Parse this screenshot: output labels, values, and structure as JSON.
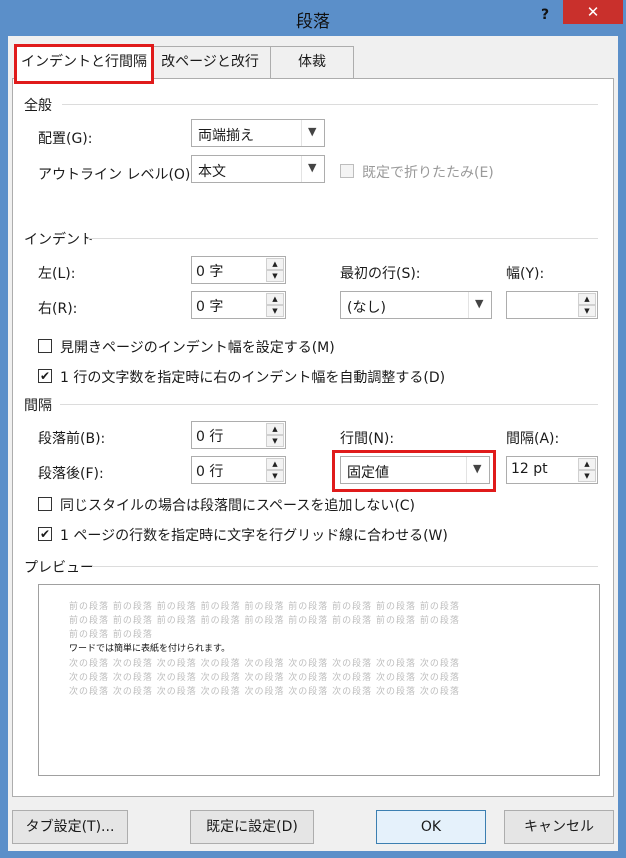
{
  "window": {
    "title": "段落",
    "help": "?",
    "close": "✕"
  },
  "tabs": [
    {
      "label": "インデントと行間隔"
    },
    {
      "label": "改ページと改行"
    },
    {
      "label": "体裁"
    }
  ],
  "general": {
    "header": "全般",
    "alignment_label": "配置(G):",
    "alignment_value": "両端揃え",
    "outline_label": "アウトライン レベル(O):",
    "outline_value": "本文",
    "collapsed_label": "既定で折りたたみ(E)"
  },
  "indent": {
    "header": "インデント",
    "left_label": "左(L):",
    "left_value": "0 字",
    "right_label": "右(R):",
    "right_value": "0 字",
    "first_line_label": "最初の行(S):",
    "first_line_value": "(なし)",
    "width_label": "幅(Y):",
    "width_value": "",
    "mirror_label": "見開きページのインデント幅を設定する(M)",
    "auto_adjust_label": "1 行の文字数を指定時に右のインデント幅を自動調整する(D)"
  },
  "spacing": {
    "header": "間隔",
    "before_label": "段落前(B):",
    "before_value": "0 行",
    "after_label": "段落後(F):",
    "after_value": "0 行",
    "line_spacing_label": "行間(N):",
    "line_spacing_value": "固定値",
    "at_label": "間隔(A):",
    "at_value": "12 pt",
    "no_space_label": "同じスタイルの場合は段落間にスペースを追加しない(C)",
    "snap_grid_label": "1 ページの行数を指定時に文字を行グリッド線に合わせる(W)"
  },
  "preview": {
    "header": "プレビュー",
    "prev_lines": [
      "前の段落 前の段落 前の段落 前の段落 前の段落 前の段落 前の段落 前の段落 前の段落",
      "前の段落 前の段落 前の段落 前の段落 前の段落 前の段落 前の段落 前の段落 前の段落",
      "前の段落 前の段落"
    ],
    "main_line": "ワードでは簡単に表紙を付けられます。",
    "next_lines": [
      "次の段落 次の段落 次の段落 次の段落 次の段落 次の段落 次の段落 次の段落 次の段落",
      "次の段落 次の段落 次の段落 次の段落 次の段落 次の段落 次の段落 次の段落 次の段落",
      "次の段落 次の段落 次の段落 次の段落 次の段落 次の段落 次の段落 次の段落 次の段落"
    ]
  },
  "buttons": {
    "tabs": "タブ設定(T)...",
    "set_default": "既定に設定(D)",
    "ok": "OK",
    "cancel": "キャンセル"
  },
  "colors": {
    "highlight": "#e01b1b",
    "titlebar": "#5b8fc9",
    "close": "#c9302c"
  }
}
